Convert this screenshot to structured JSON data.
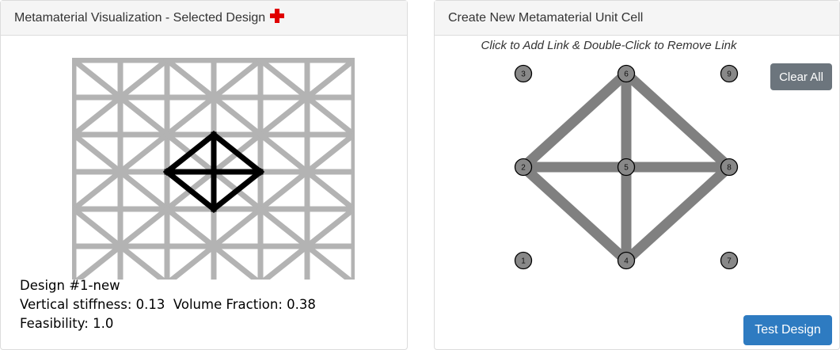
{
  "left_panel": {
    "title": "Metamaterial Visualization - Selected Design",
    "cross_color": "#e00000",
    "design_name": "Design #1-new",
    "stiffness_text": "Vertical stiffness: 0.13",
    "volume_text": "Volume Fraction: 0.38",
    "feasibility_text": "Feasibility: 1.0",
    "lattice": {
      "grid": [
        3,
        3
      ],
      "tile_links": [
        [
          1,
          4
        ],
        [
          4,
          7
        ],
        [
          7,
          9
        ],
        [
          9,
          6
        ],
        [
          6,
          3
        ],
        [
          3,
          1
        ],
        [
          1,
          9
        ],
        [
          7,
          3
        ],
        [
          2,
          8
        ],
        [
          4,
          6
        ]
      ],
      "highlight_links": [
        [
          2,
          6
        ],
        [
          6,
          8
        ],
        [
          8,
          4
        ],
        [
          4,
          2
        ],
        [
          2,
          8
        ],
        [
          6,
          4
        ]
      ],
      "lattice_color": "#b3b3b3",
      "highlight_color": "#000000"
    }
  },
  "right_panel": {
    "title": "Create New Metamaterial Unit Cell",
    "instructions": "Click to Add Link & Double-Click to Remove Link",
    "clear_button": "Clear All",
    "test_button": "Test Design",
    "nodes": [
      {
        "id": "1",
        "col": 0,
        "row": 2
      },
      {
        "id": "2",
        "col": 0,
        "row": 1
      },
      {
        "id": "3",
        "col": 0,
        "row": 0
      },
      {
        "id": "4",
        "col": 1,
        "row": 2
      },
      {
        "id": "5",
        "col": 1,
        "row": 1
      },
      {
        "id": "6",
        "col": 1,
        "row": 0
      },
      {
        "id": "7",
        "col": 2,
        "row": 2
      },
      {
        "id": "8",
        "col": 2,
        "row": 1
      },
      {
        "id": "9",
        "col": 2,
        "row": 0
      }
    ],
    "links": [
      [
        "2",
        "6"
      ],
      [
        "6",
        "8"
      ],
      [
        "8",
        "4"
      ],
      [
        "4",
        "2"
      ],
      [
        "2",
        "8"
      ],
      [
        "6",
        "4"
      ]
    ],
    "link_color": "#808080",
    "node_fill": "#888888"
  }
}
